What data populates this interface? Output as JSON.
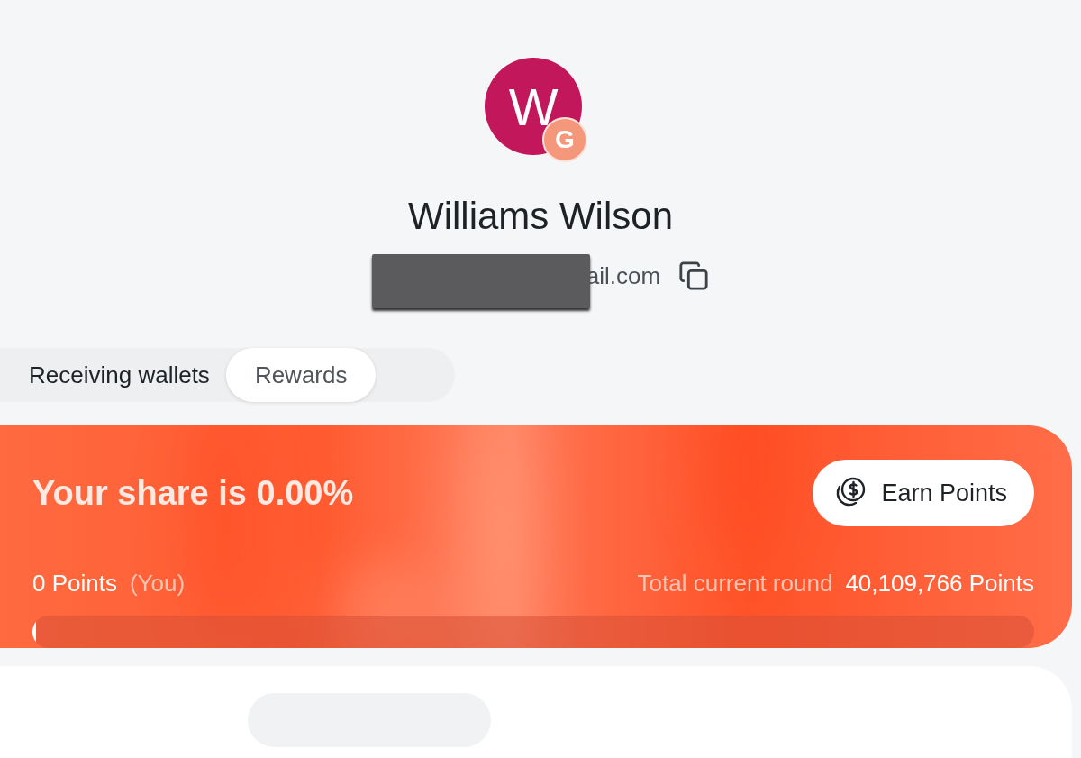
{
  "profile": {
    "initial": "W",
    "provider_badge": "G",
    "name": "Williams Wilson",
    "email": "ail.com"
  },
  "tabs": [
    {
      "label": "Receiving wallets",
      "selected": false
    },
    {
      "label": "Rewards",
      "selected": true
    }
  ],
  "rewards": {
    "share": "Your share is 0.00%",
    "button": "Earn Points",
    "your_points": "0 Points",
    "you_label": "(You)",
    "total_label": "Total current round",
    "total_points": "40,109,766 Points",
    "level": 0.004
  }
}
